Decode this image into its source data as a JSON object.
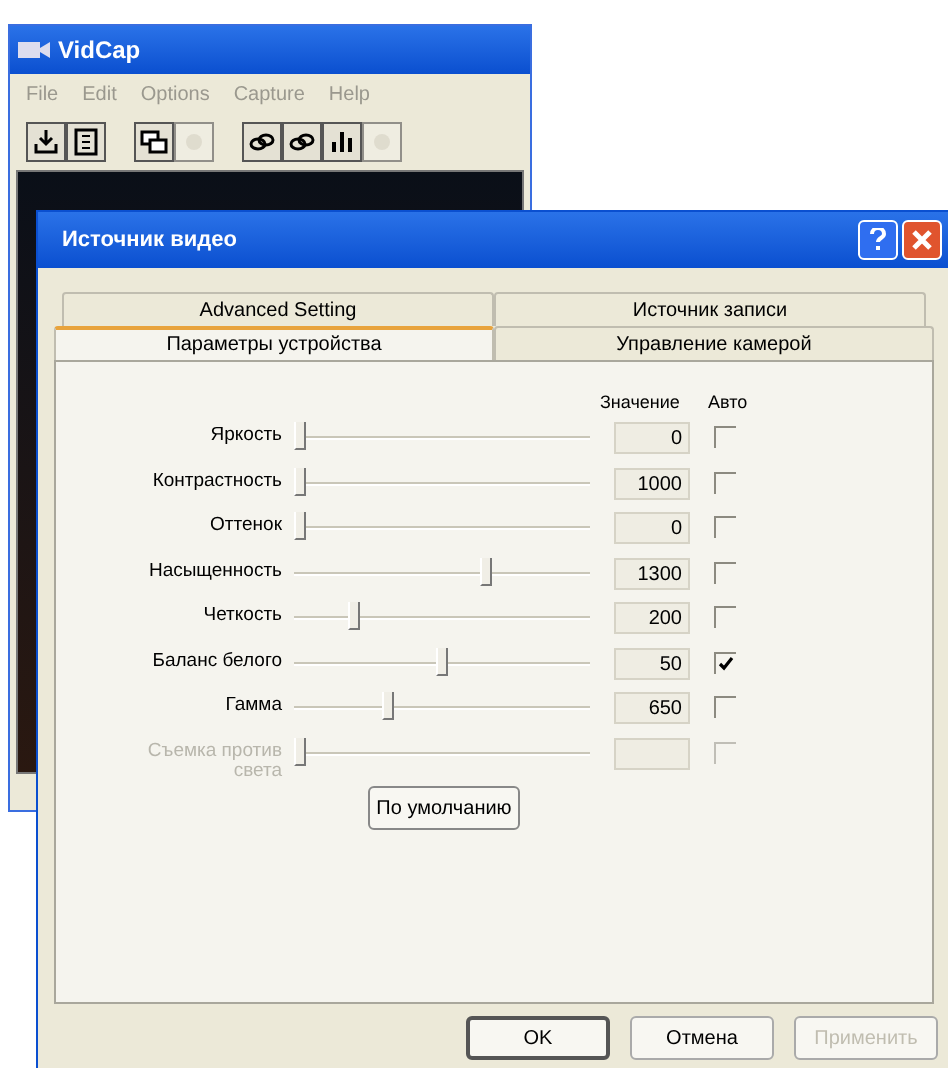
{
  "back_window": {
    "title": "VidCap",
    "menu": [
      "File",
      "Edit",
      "Options",
      "Capture",
      "Help"
    ],
    "toolbar": [
      {
        "kind": "save",
        "disabled": false
      },
      {
        "kind": "film",
        "disabled": false
      },
      {
        "kind": "overlay",
        "disabled": false
      },
      {
        "kind": "blank",
        "disabled": true
      },
      {
        "kind": "link",
        "disabled": false
      },
      {
        "kind": "link",
        "disabled": false
      },
      {
        "kind": "chart",
        "disabled": false
      },
      {
        "kind": "blank",
        "disabled": true
      }
    ]
  },
  "dialog": {
    "title": "Источник видео",
    "tab_rows": [
      [
        {
          "label": "Advanced Setting",
          "selected": false
        },
        {
          "label": "Источник записи",
          "selected": false
        }
      ],
      [
        {
          "label": "Параметры устройства",
          "selected": true
        },
        {
          "label": "Управление камерой",
          "selected": false
        }
      ]
    ],
    "columns": {
      "value": "Значение",
      "auto": "Авто"
    },
    "settings": [
      {
        "label": "Яркость",
        "level": 0.02,
        "value": "0",
        "auto": false,
        "disabled": false
      },
      {
        "label": "Контрастность",
        "level": 0.02,
        "value": "1000",
        "auto": false,
        "disabled": false
      },
      {
        "label": "Оттенок",
        "level": 0.02,
        "value": "0",
        "auto": false,
        "disabled": false
      },
      {
        "label": "Насыщенность",
        "level": 0.65,
        "value": "1300",
        "auto": false,
        "disabled": false
      },
      {
        "label": "Четкость",
        "level": 0.2,
        "value": "200",
        "auto": false,
        "disabled": false
      },
      {
        "label": "Баланс белого",
        "level": 0.5,
        "value": "50",
        "auto": true,
        "disabled": false
      },
      {
        "label": "Гамма",
        "level": 0.32,
        "value": "650",
        "auto": false,
        "disabled": false
      },
      {
        "label": "Съемка против света",
        "level": 0.02,
        "auto": false,
        "disabled": true
      }
    ],
    "default_button": "По умолчанию",
    "buttons": [
      {
        "label": "OK",
        "disabled": false,
        "default": true
      },
      {
        "label": "Отмена",
        "disabled": false,
        "default": false
      },
      {
        "label": "Применить",
        "disabled": true,
        "default": false
      }
    ]
  }
}
